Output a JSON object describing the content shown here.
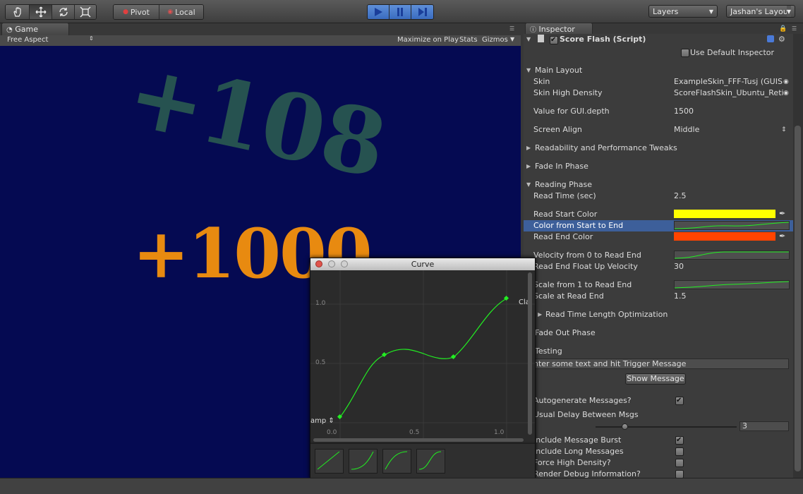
{
  "toolbar": {
    "pivot_label": "Pivot",
    "local_label": "Local",
    "layers_label": "Layers",
    "layout_label": "Jashan's Layout"
  },
  "game": {
    "tab_label": "Game",
    "aspect_label": "Free Aspect",
    "maximize_label": "Maximize on Play",
    "stats_label": "Stats",
    "gizmos_label": "Gizmos",
    "score_top": "+108",
    "score_bottom": "+1000"
  },
  "curve_window": {
    "title": "Curve",
    "y_ticks": [
      "1.0",
      "0.5"
    ],
    "x_ticks": [
      "0.0",
      "0.5",
      "1.0"
    ],
    "left_wrap_label": "amp",
    "right_wrap_label": "Clan"
  },
  "inspector": {
    "tab_label": "Inspector",
    "component_title": "Score Flash (Script)",
    "use_default_label": "Use Default Inspector",
    "main_layout": "Main Layout",
    "skin_label": "Skin",
    "skin_value": "ExampleSkin_FFF-Tusj (GUISkin)",
    "skin_hd_label": "Skin High Density",
    "skin_hd_value": "ScoreFlashSkin_Ubuntu_Retina",
    "gui_depth_label": "Value for GUI.depth",
    "gui_depth_value": "1500",
    "screen_align_label": "Screen Align",
    "screen_align_value": "Middle",
    "readability_label": "Readability and Performance Tweaks",
    "fade_in_label": "Fade In Phase",
    "reading_phase_label": "Reading Phase",
    "read_time_label": "Read Time (sec)",
    "read_time_value": "2.5",
    "read_start_color_label": "Read Start Color",
    "color_start_end_label": "Color from Start to End",
    "read_end_color_label": "Read End Color",
    "velocity_label": "Velocity from 0 to Read End",
    "float_up_label": "Read End Float Up Velocity",
    "float_up_value": "30",
    "scale_label": "Scale from 1 to Read End",
    "scale_end_label": "Scale at Read End",
    "scale_end_value": "1.5",
    "read_time_opt_label": "Read Time Length Optimization",
    "fade_out_label": "Fade Out Phase",
    "testing_label": "Testing",
    "message_input": "nter some text and hit Trigger Message",
    "show_message_label": "Show Message",
    "autogen_label": "Autogenerate Messages?",
    "usual_delay_label": "Usual Delay Between Msgs",
    "usual_delay_value": "3",
    "include_burst_label": "Include Message Burst",
    "include_long_label": "Include Long Messages",
    "force_hd_label": "Force High Density?",
    "render_debug_label": "Render Debug Information?"
  },
  "colors": {
    "read_start_color": "#ffff00",
    "read_end_color": "#ff4400",
    "highlight_row": "#3d5f9a",
    "curve_green": "#22ee22",
    "score_top_color": "#2a5a50",
    "score_bottom_color": "#e88a10"
  }
}
